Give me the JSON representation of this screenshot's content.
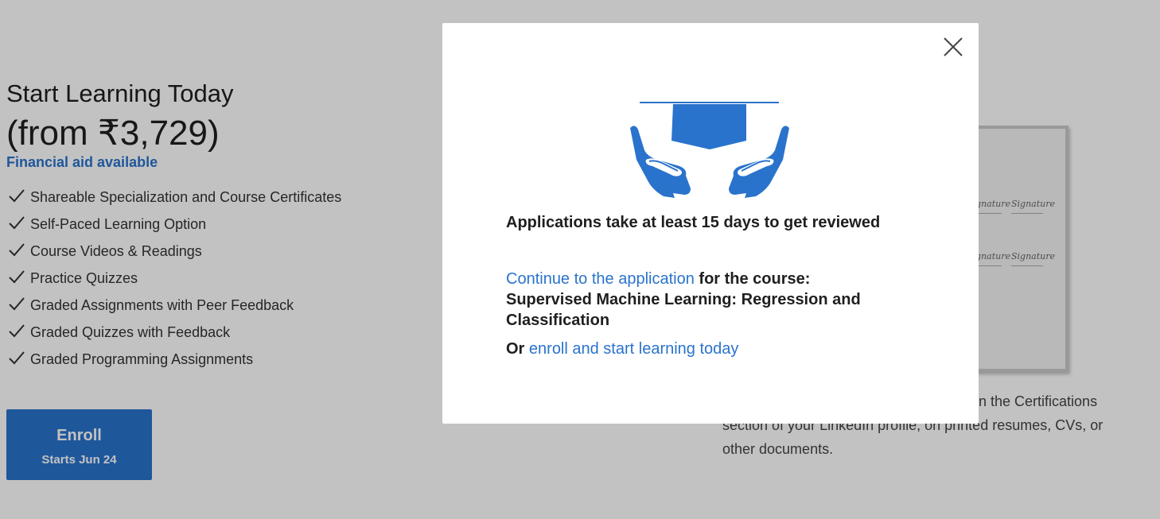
{
  "left": {
    "title": "Start Learning Today",
    "price": "(from ₹3,729)",
    "financial_aid": "Financial aid available",
    "features": [
      "Shareable Specialization and Course Certificates",
      "Self-Paced Learning Option",
      "Course Videos & Readings",
      "Practice Quizzes",
      "Graded Assignments with Peer Feedback",
      "Graded Quizzes with Feedback",
      "Graded Programming Assignments"
    ],
    "enroll": {
      "label": "Enroll",
      "sub": "Starts Jun 24"
    }
  },
  "right": {
    "text_line1": "in the Certifications",
    "text_line2": "section of your LinkedIn profile, on printed resumes, CVs, or",
    "text_line3": "other documents.",
    "signature_word": "Signature"
  },
  "modal": {
    "close_icon": "close-icon",
    "heading": "Applications take at least 15 days to get reviewed",
    "continue_link": "Continue to the application",
    "for_course": "for the course:",
    "course_name": "Supervised Machine Learning: Regression and Classification",
    "or_text": "Or",
    "enroll_link": "enroll and start learning today"
  },
  "colors": {
    "accent": "#2a73cc",
    "overlay": "rgba(0,0,0,0.24)"
  }
}
